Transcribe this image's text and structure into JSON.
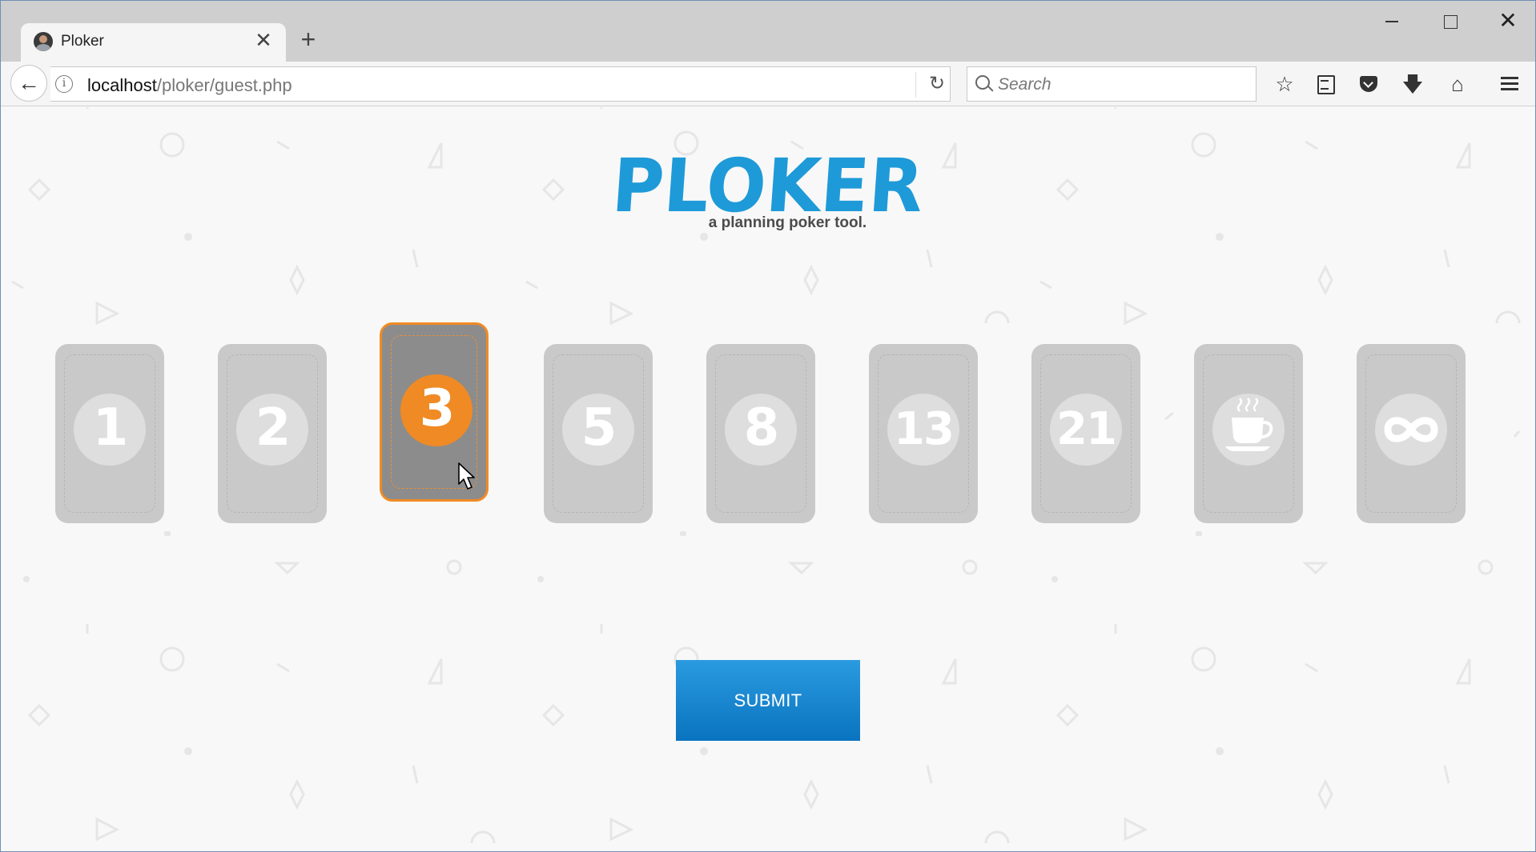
{
  "browser": {
    "tab_title": "Ploker",
    "url_host": "localhost",
    "url_path": "/ploker/guest.php",
    "search_placeholder": "Search"
  },
  "app": {
    "logo_text": "PLOKER",
    "tagline": "a planning poker tool.",
    "accent_color": "#f08a24",
    "brand_color": "#1e9ad8",
    "selected_card": "3"
  },
  "cards": [
    {
      "value": "1",
      "icon": null
    },
    {
      "value": "2",
      "icon": null
    },
    {
      "value": "3",
      "icon": null
    },
    {
      "value": "5",
      "icon": null
    },
    {
      "value": "8",
      "icon": null
    },
    {
      "value": "13",
      "icon": null
    },
    {
      "value": "21",
      "icon": null
    },
    {
      "value": "",
      "icon": "coffee-icon"
    },
    {
      "value": "",
      "icon": "infinity-icon"
    }
  ],
  "submit_label": "SUBMIT"
}
